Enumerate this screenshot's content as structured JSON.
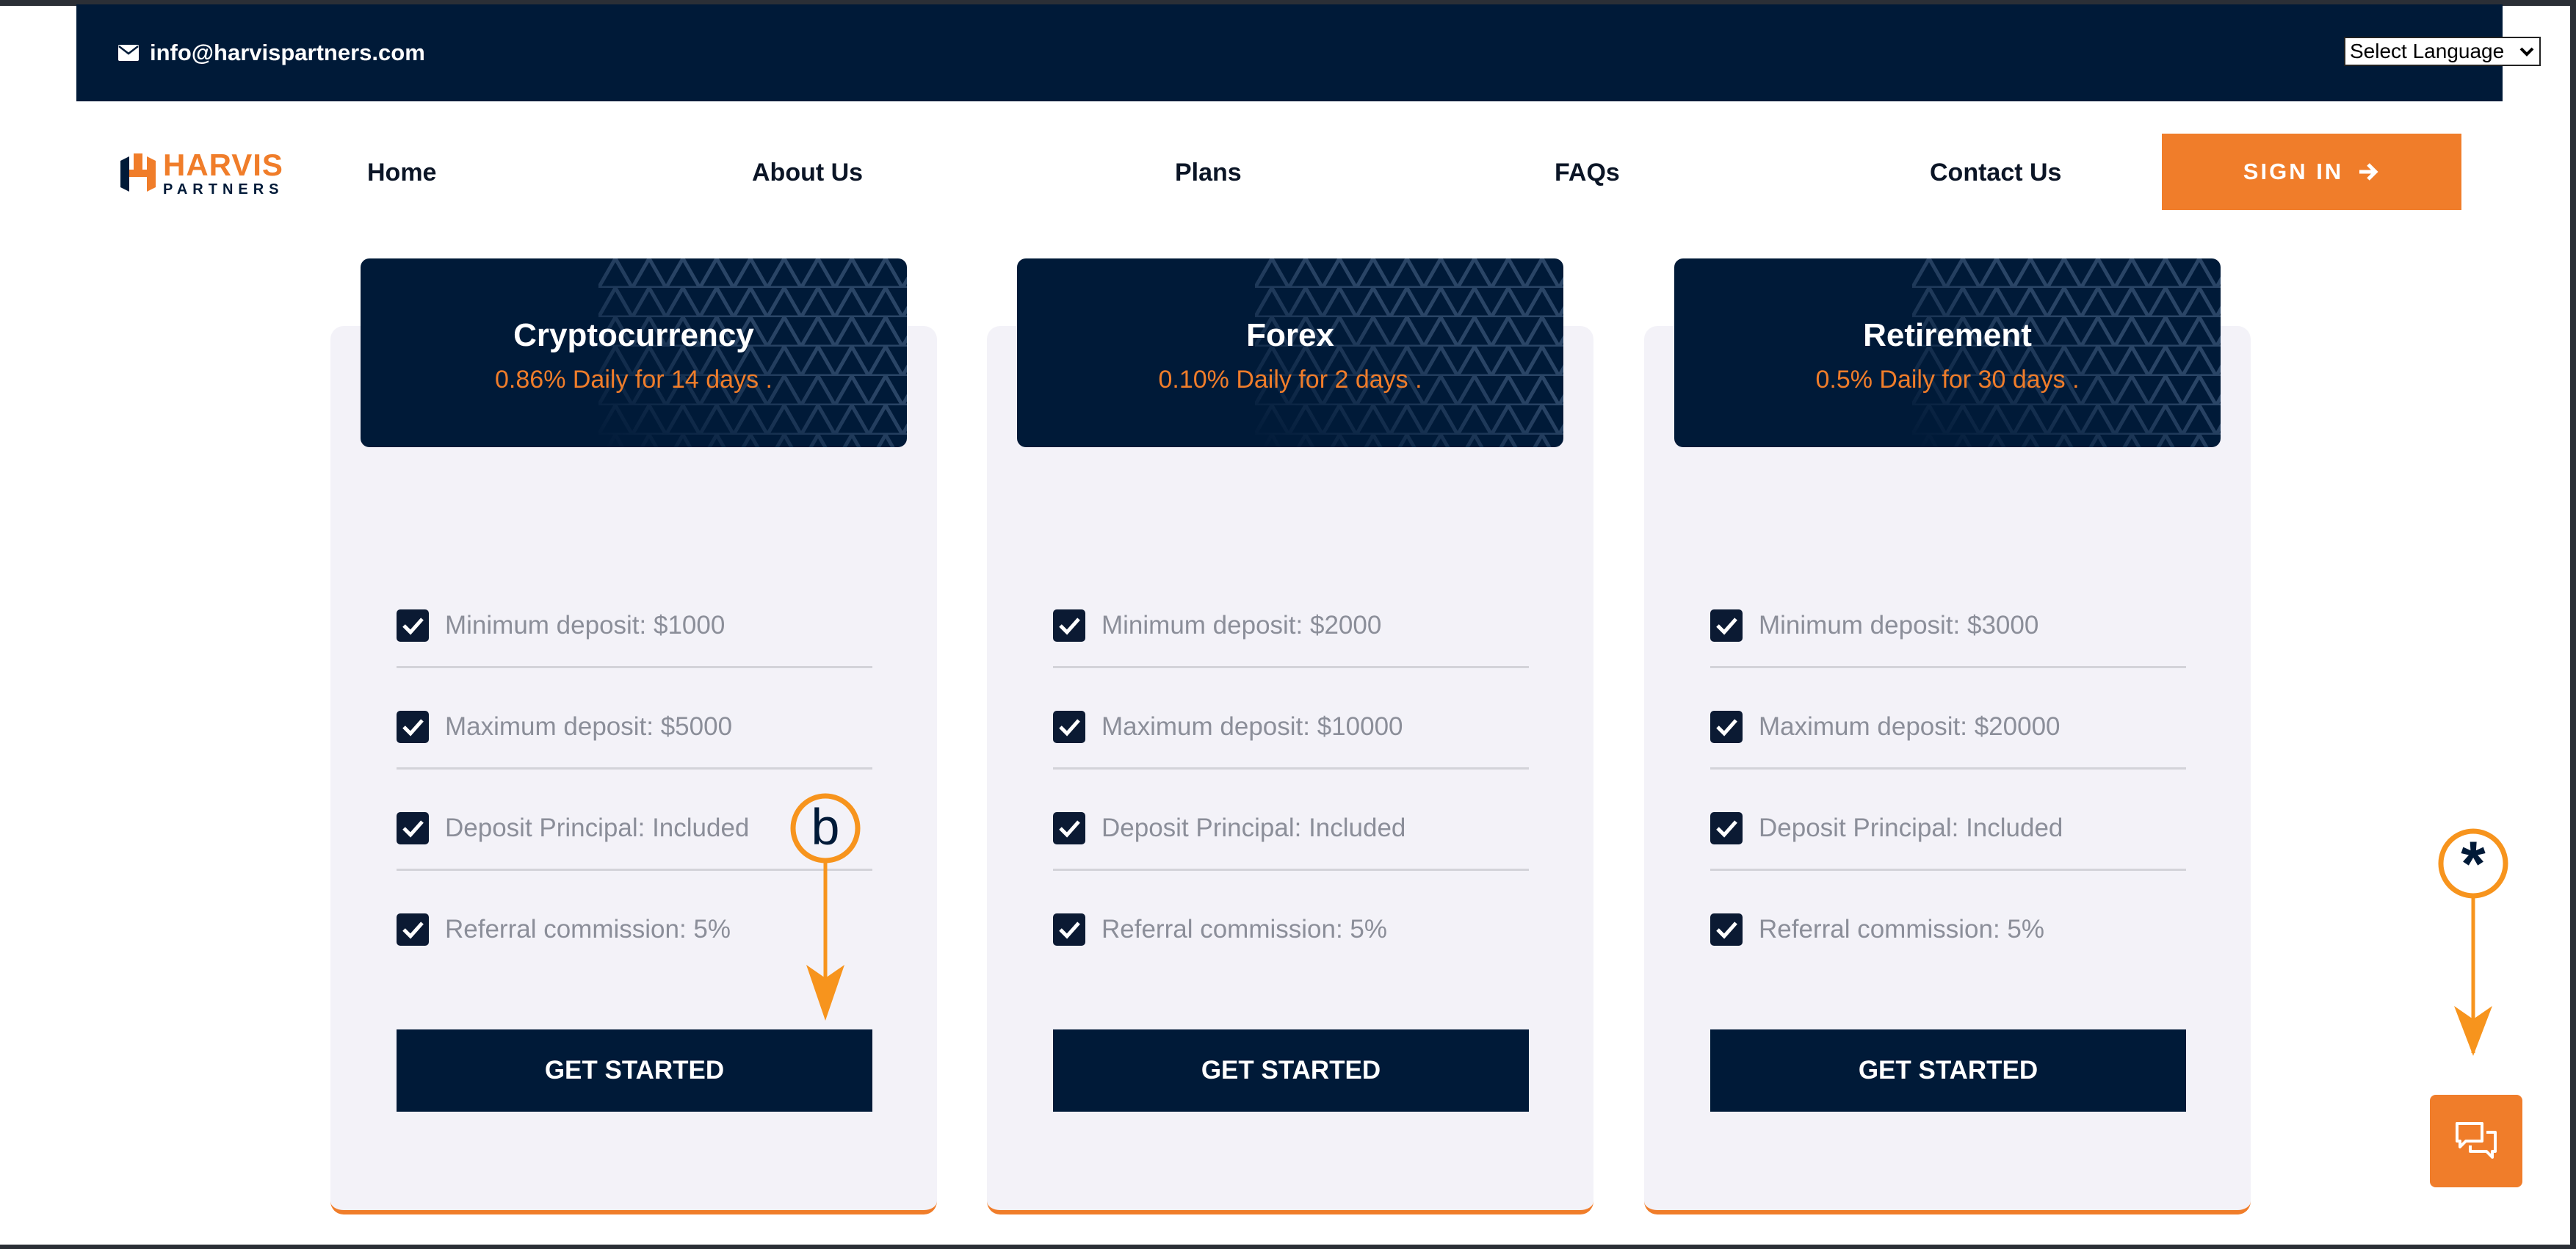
{
  "topbar": {
    "email": "info@harvispartners.com",
    "language_select": "Select Language"
  },
  "logo": {
    "line1": "HARVIS",
    "line2": "PARTNERS"
  },
  "nav": {
    "items": [
      {
        "label": "Home"
      },
      {
        "label": "About Us"
      },
      {
        "label": "Plans"
      },
      {
        "label": "FAQs"
      },
      {
        "label": "Contact Us"
      }
    ],
    "signin_label": "SIGN IN"
  },
  "plans": [
    {
      "title": "Cryptocurrency",
      "rate": "0.86% Daily for 14 days .",
      "features": [
        "Minimum deposit: $1000",
        "Maximum deposit: $5000",
        "Deposit Principal: Included",
        "Referral commission: 5%"
      ],
      "button": "GET STARTED"
    },
    {
      "title": "Forex",
      "rate": "0.10% Daily for 2 days .",
      "features": [
        "Minimum deposit: $2000",
        "Maximum deposit: $10000",
        "Deposit Principal: Included",
        "Referral commission: 5%"
      ],
      "button": "GET STARTED"
    },
    {
      "title": "Retirement",
      "rate": "0.5% Daily for 30 days .",
      "features": [
        "Minimum deposit: $3000",
        "Maximum deposit: $20000",
        "Deposit Principal: Included",
        "Referral commission: 5%"
      ],
      "button": "GET STARTED"
    }
  ],
  "annotations": {
    "b": "b",
    "star": "*"
  },
  "colors": {
    "navy": "#001a38",
    "accent": "#f07d2a",
    "annotation": "#f7941d"
  },
  "icons": {
    "email": "envelope-icon",
    "signin": "arrow-right-icon",
    "check": "checkbox-checked-icon",
    "chat": "chat-bubbles-icon"
  }
}
